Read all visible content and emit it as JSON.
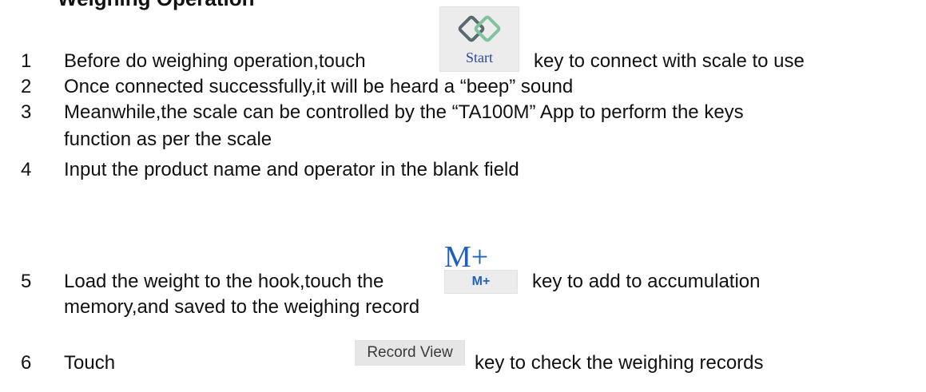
{
  "heading": {
    "text": "Weighing Operation"
  },
  "steps": [
    {
      "num": "1",
      "before": "Before do weighing operation,touch",
      "after": "key to connect with scale to use"
    },
    {
      "num": "2",
      "text": "Once connected successfully,it will be heard a “beep” sound"
    },
    {
      "num": "3",
      "line1": "Meanwhile,the scale can be controlled by the “TA100M” App to perform the keys",
      "line2": "function as per the scale"
    },
    {
      "num": "4",
      "text": "Input the product name and operator in the blank field"
    },
    {
      "num": "5",
      "before": "Load the weight to the hook,touch the",
      "after": "key to add to accumulation",
      "line2": "memory,and saved to the weighing record"
    },
    {
      "num": "6",
      "before": "Touch",
      "after": "key to check the weighing records"
    }
  ],
  "keys": {
    "start_label": "Start",
    "start_icon": "link-icon",
    "mplus_large": "M+",
    "mplus_label": "M+",
    "record_view_label": "Record View"
  },
  "colors": {
    "start_label": "#2a4aa0",
    "mplus": "#1f5fbf",
    "key_bg": "#ececec",
    "link_icon_dark": "#5a6b70",
    "link_icon_light": "#7fc29b"
  }
}
